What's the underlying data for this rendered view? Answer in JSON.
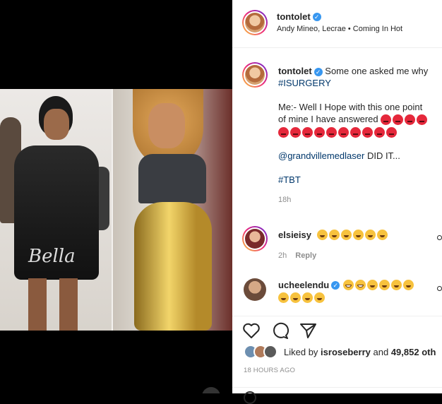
{
  "post": {
    "username": "tontolet",
    "verified_mark": "✓",
    "music": "Andy Mineo, Lecrae • Coming In Hot",
    "watermark": "Bella"
  },
  "caption": {
    "username": "tontolet",
    "line1": "Some one asked me why",
    "hashtag1": "#ISURGERY",
    "line2": "Me:- Well I Hope with this one point",
    "line3": "of mine I have answered",
    "mention": "@grandvillemedlaser",
    "mention_suffix": "DID IT...",
    "hashtag2": "#TBT",
    "time": "18h"
  },
  "comments": [
    {
      "username": "elsieisy",
      "time": "2h",
      "reply_label": "Reply",
      "emoji": [
        "laugh",
        "laugh",
        "laugh",
        "laugh",
        "laugh",
        "laugh"
      ]
    },
    {
      "username": "ucheelendu",
      "emoji": [
        "grin",
        "grin",
        "laugh",
        "laugh",
        "laugh",
        "laugh",
        "laugh",
        "laugh",
        "laugh",
        "laugh"
      ]
    }
  ],
  "likes": {
    "prefix": "Liked by",
    "user": "isroseberry",
    "joiner": "and",
    "count": "49,852 oth"
  },
  "timestamp": "18 HOURS AGO",
  "colors": {
    "link": "#00376b",
    "verified": "#3897f0",
    "muted": "#8e8e8e"
  }
}
